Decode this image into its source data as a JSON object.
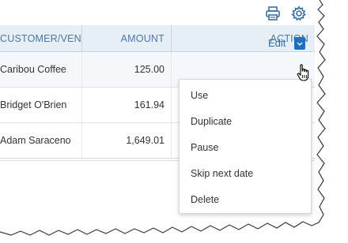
{
  "toolbar": {
    "print_icon": "printer-icon",
    "settings_icon": "gear-icon"
  },
  "table": {
    "columns": [
      "CUSTOMER/VEN",
      "AMOUNT",
      "ACTION"
    ],
    "rows": [
      {
        "customer": "Caribou Coffee",
        "amount": "125.00"
      },
      {
        "customer": "Bridget O'Brien",
        "amount": "161.94"
      },
      {
        "customer": "Adam Saraceno",
        "amount": "1,649.01"
      }
    ],
    "edit_label": "Edit"
  },
  "menu": {
    "items": [
      "Use",
      "Duplicate",
      "Pause",
      "Skip next date",
      "Delete"
    ]
  },
  "colors": {
    "header_bg": "#e6eef6",
    "header_text": "#4e77a3",
    "link": "#2e6fb0",
    "toggle": "#1f6fbf"
  }
}
